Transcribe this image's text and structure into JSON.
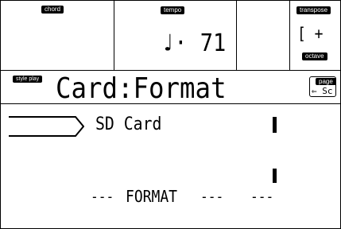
{
  "header": {
    "chord_label": "chord",
    "tempo_label": "tempo",
    "tempo_value": "♩· 71",
    "transpose_label": "transpose",
    "transpose_value": "[ +",
    "octave_label": "octave"
  },
  "title_bar": {
    "mode_label": "style play",
    "title": "Card:Format",
    "page_label": "page",
    "page_value": "⇐ Sc"
  },
  "main": {
    "device_label": "SD Card",
    "format_label": "FORMAT",
    "dash_left": "---",
    "dash_mid": "---",
    "dash_right": "---"
  }
}
